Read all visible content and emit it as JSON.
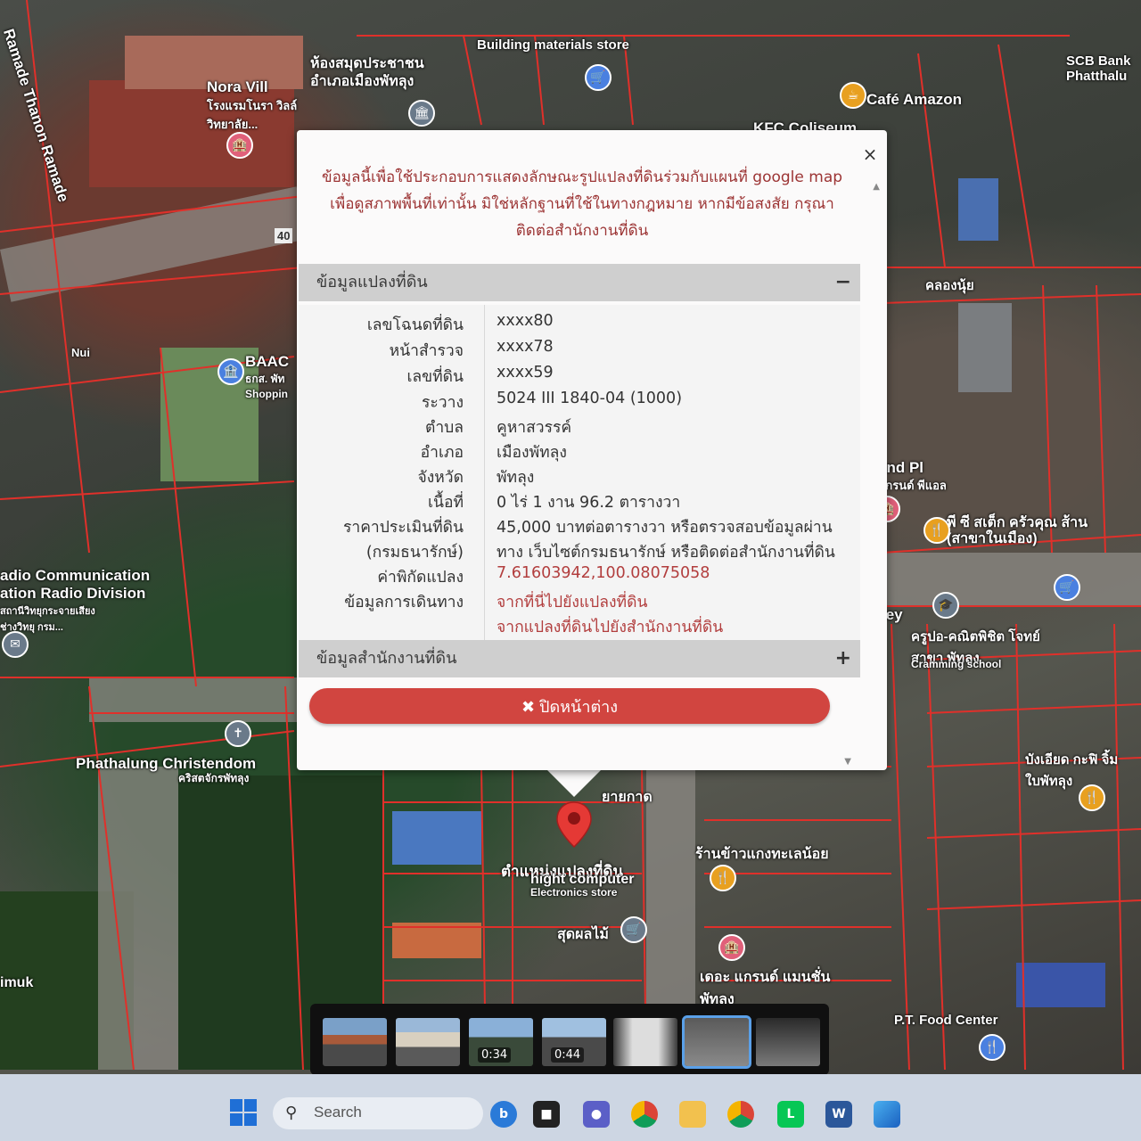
{
  "map": {
    "labels": {
      "building_materials": "Building materials store",
      "library": "ห้องสมุดประชาชน อำเภอเมืองพัทลุง",
      "cafe_amazon": "Café Amazon",
      "scb": "SCB Bank Phatthalu",
      "nora_vill": "Nora Vill",
      "nora_thai": "โรงแรมโนรา วิลล์ วิทยาลัย...",
      "kfc": "KFC Coliseum",
      "ramade": "Ramade Thanon Ramade",
      "nui": "Nui",
      "baac": "BAAC",
      "baac_sub": "ธกส. พัท Shoppin",
      "khlong": "คลองนุ้ย",
      "grand_pl": "and Pl",
      "grand_thai": "แกรนด์ พีแอล",
      "pc_shop": "พี ซี สเต็ก ครัวคุณ ส้าน (สาขาในเมือง)",
      "radio": "adio Communication ation Radio Division",
      "radio_thai": "สถานีวิทยุกระจายเสียง ช่างวิทยุ กรม...",
      "alley": "Alley",
      "cram": "ครูปอ-คณิตพิชิต โจทย์ สาขา พัทลุง",
      "cram_en": "Cramming school",
      "christendom": "Phathalung Christendom",
      "christendom_thai": "คริสตจักรพัทลุง",
      "yaitapat": "ยายกาด",
      "noodle": "ร้านข้าวแกงทะเลน้อย",
      "bangiad": "บังเอียด กะฟิ จิ้มใบพัทลุง",
      "parcel_pos": "ตำแหน่งแปลงที่ดิน",
      "hight": "hight computer",
      "electronics": "Electronics store",
      "sudpol": "สุดผลไม้",
      "the_grand": "เดอะ แกรนด์ แมนชั่น พัทลุง",
      "pt_food": "P.T. Food Center",
      "imuk": "imuk",
      "sign_40": "40"
    }
  },
  "dialog": {
    "notice_line1": "ข้อมูลนี้เพื่อใช้ประกอบการแสดงลักษณะรูปแปลงที่ดินร่วมกับแผนที่ google map",
    "notice_line2": "เพื่อดูสภาพพื้นที่เท่านั้น มิใช่หลักฐานที่ใช้ในทางกฎหมาย หากมีข้อสงสัย กรุณา",
    "notice_line3": "ติดต่อสำนักงานที่ดิน",
    "close_x": "×",
    "section_land": "ข้อมูลแปลงที่ดิน",
    "section_land_toggle": "−",
    "section_office": "ข้อมูลสำนักงานที่ดิน",
    "section_office_toggle": "+",
    "rows": [
      {
        "key": "เลขโฉนดที่ดิน",
        "value": "xxxx80"
      },
      {
        "key": "หน้าสำรวจ",
        "value": "xxxx78"
      },
      {
        "key": "เลขที่ดิน",
        "value": "xxxx59"
      },
      {
        "key": "ระวาง",
        "value": "5024 III 1840-04 (1000)"
      },
      {
        "key": "ตำบล",
        "value": "คูหาสวรรค์"
      },
      {
        "key": "อำเภอ",
        "value": "เมืองพัทลุง"
      },
      {
        "key": "จังหวัด",
        "value": "พัทลุง"
      },
      {
        "key": "เนื้อที่",
        "value": "0 ไร่ 1 งาน 96.2 ตารางวา"
      },
      {
        "key": "ราคาประเมินที่ดิน",
        "value": "45,000 บาทต่อตารางวา หรือตรวจสอบข้อมูลผ่าน"
      },
      {
        "key": "(กรมธนารักษ์)",
        "value": "ทาง เว็บไซต์กรมธนารักษ์ หรือติดต่อสำนักงานที่ดิน"
      },
      {
        "key": "ค่าพิกัดแปลง",
        "value": "7.61603942,100.08075058"
      },
      {
        "key": "ข้อมูลการเดินทาง",
        "value": "จากที่นี่ไปยังแปลงที่ดิน"
      },
      {
        "key": "",
        "value": "จากแปลงที่ดินไปยังสำนักงานที่ดิน"
      }
    ],
    "close_button": "✖ ปิดหน้าต่าง"
  },
  "thumbnails": [
    {
      "duration": ""
    },
    {
      "duration": ""
    },
    {
      "duration": "0:34"
    },
    {
      "duration": "0:44"
    },
    {
      "duration": ""
    },
    {
      "duration": ""
    },
    {
      "duration": ""
    }
  ],
  "taskbar": {
    "search_label": "Search"
  }
}
